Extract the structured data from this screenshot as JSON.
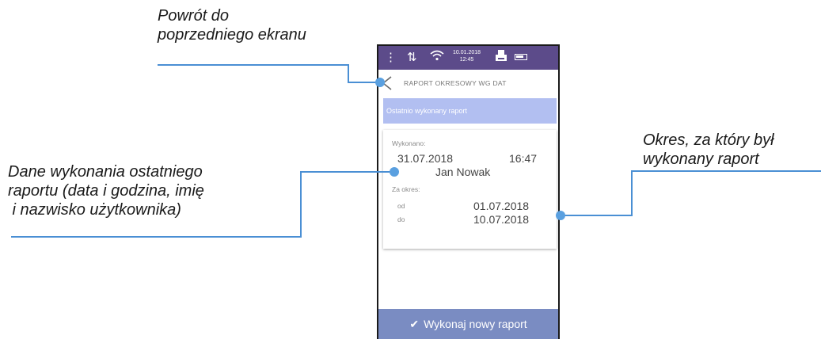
{
  "callouts": {
    "back": [
      "Powrót do",
      "poprzedniego ekranu"
    ],
    "data": [
      "Dane wykonania ostatniego",
      "raportu (data i godzina, imię",
      " i nazwisko użytkownika)"
    ],
    "period": [
      "Okres, za który był",
      "wykonany raport"
    ]
  },
  "status": {
    "date": "10.01.2018",
    "time": "12:45"
  },
  "header": {
    "title": "RAPORT OKRESOWY WG DAT"
  },
  "banner": "Ostatnio wykonany raport",
  "report": {
    "done_label": "Wykonano:",
    "date": "31.07.2018",
    "time": "16:47",
    "user": "Jan Nowak",
    "period_label": "Za okres:",
    "from_label": "od",
    "from": "01.07.2018",
    "to_label": "do",
    "to": "10.07.2018"
  },
  "button": {
    "label": "Wykonaj nowy raport"
  },
  "colors": {
    "statusbar": "#5c4b8a",
    "banner": "#b2bff1",
    "button": "#7a8cc2",
    "callout_line": "#4a8fd4"
  }
}
